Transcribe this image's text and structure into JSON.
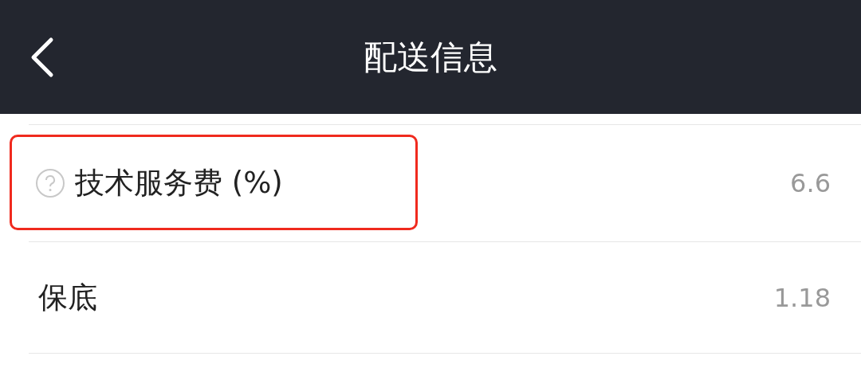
{
  "header": {
    "title": "配送信息"
  },
  "rows": [
    {
      "label": "技术服务费 (%)",
      "value": "6.6",
      "help_icon": true,
      "highlighted": true
    },
    {
      "label": "保底",
      "value": "1.18",
      "help_icon": false,
      "highlighted": false
    }
  ]
}
